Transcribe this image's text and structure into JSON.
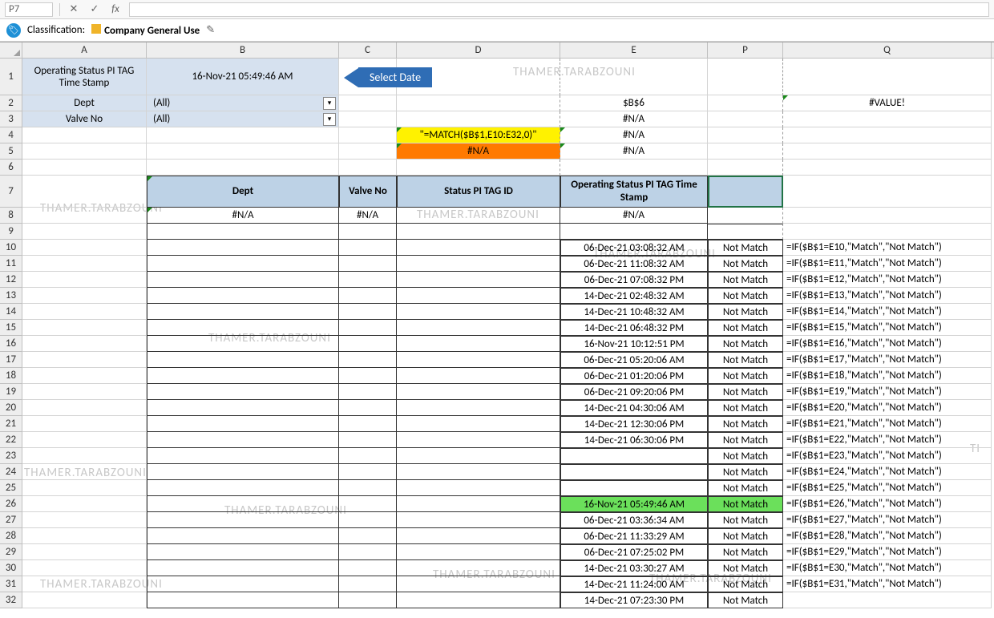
{
  "classification": {
    "label": "Classification:",
    "value": "Company General Use"
  },
  "nameBox": "P7",
  "columns": [
    "A",
    "B",
    "C",
    "D",
    "E",
    "P",
    "Q"
  ],
  "top": {
    "a1": "Operating Status PI TAG Time Stamp",
    "b1": "16-Nov-21 05:49:46 AM",
    "a2": "Dept",
    "b2": "(All)",
    "a3": "Valve No",
    "b3": "(All)",
    "d4": "\"=MATCH($B$1,E10:E32,0)\"",
    "d5": "#N/A",
    "e2": "$B$6",
    "e3": "#N/A",
    "e4": "#N/A",
    "e5": "#N/A",
    "q2": "#VALUE!"
  },
  "callout": "Select Date",
  "tableHeaders": {
    "b7": "Dept",
    "c7": "Valve No",
    "d7": "Status PI TAG ID",
    "e7": "Operating Status PI TAG Time Stamp"
  },
  "row8": {
    "b": "#N/A",
    "c": "#N/A",
    "e": "#N/A"
  },
  "dataRows": [
    {
      "r": 10,
      "e": "06-Dec-21 03:08:32 AM",
      "p": "Not Match",
      "q": "=IF($B$1=E10,\"Match\",\"Not Match\")"
    },
    {
      "r": 11,
      "e": "06-Dec-21 11:08:32 AM",
      "p": "Not Match",
      "q": "=IF($B$1=E11,\"Match\",\"Not Match\")"
    },
    {
      "r": 12,
      "e": "06-Dec-21 07:08:32 PM",
      "p": "Not Match",
      "q": "=IF($B$1=E12,\"Match\",\"Not Match\")"
    },
    {
      "r": 13,
      "e": "14-Dec-21 02:48:32 AM",
      "p": "Not Match",
      "q": "=IF($B$1=E13,\"Match\",\"Not Match\")"
    },
    {
      "r": 14,
      "e": "14-Dec-21 10:48:32 AM",
      "p": "Not Match",
      "q": "=IF($B$1=E14,\"Match\",\"Not Match\")"
    },
    {
      "r": 15,
      "e": "14-Dec-21 06:48:32 PM",
      "p": "Not Match",
      "q": "=IF($B$1=E15,\"Match\",\"Not Match\")"
    },
    {
      "r": 16,
      "e": "16-Nov-21 10:12:51 PM",
      "p": "Not Match",
      "q": "=IF($B$1=E16,\"Match\",\"Not Match\")"
    },
    {
      "r": 17,
      "e": "06-Dec-21 05:20:06 AM",
      "p": "Not Match",
      "q": "=IF($B$1=E17,\"Match\",\"Not Match\")"
    },
    {
      "r": 18,
      "e": "06-Dec-21 01:20:06 PM",
      "p": "Not Match",
      "q": "=IF($B$1=E18,\"Match\",\"Not Match\")"
    },
    {
      "r": 19,
      "e": "06-Dec-21 09:20:06 PM",
      "p": "Not Match",
      "q": "=IF($B$1=E19,\"Match\",\"Not Match\")"
    },
    {
      "r": 20,
      "e": "14-Dec-21 04:30:06 AM",
      "p": "Not Match",
      "q": "=IF($B$1=E20,\"Match\",\"Not Match\")"
    },
    {
      "r": 21,
      "e": "14-Dec-21 12:30:06 PM",
      "p": "Not Match",
      "q": "=IF($B$1=E21,\"Match\",\"Not Match\")"
    },
    {
      "r": 22,
      "e": "14-Dec-21 06:30:06 PM",
      "p": "Not Match",
      "q": "=IF($B$1=E22,\"Match\",\"Not Match\")"
    },
    {
      "r": 23,
      "e": "",
      "p": "Not Match",
      "q": "=IF($B$1=E23,\"Match\",\"Not Match\")"
    },
    {
      "r": 24,
      "e": "",
      "p": "Not Match",
      "q": "=IF($B$1=E24,\"Match\",\"Not Match\")"
    },
    {
      "r": 25,
      "e": "",
      "p": "Not Match",
      "q": "=IF($B$1=E25,\"Match\",\"Not Match\")"
    },
    {
      "r": 26,
      "e": "16-Nov-21 05:49:46 AM",
      "p": "Not Match",
      "q": "=IF($B$1=E26,\"Match\",\"Not Match\")",
      "hl": true
    },
    {
      "r": 27,
      "e": "06-Dec-21 03:36:34 AM",
      "p": "Not Match",
      "q": "=IF($B$1=E27,\"Match\",\"Not Match\")"
    },
    {
      "r": 28,
      "e": "06-Dec-21 11:33:29 AM",
      "p": "Not Match",
      "q": "=IF($B$1=E28,\"Match\",\"Not Match\")"
    },
    {
      "r": 29,
      "e": "06-Dec-21 07:25:02 PM",
      "p": "Not Match",
      "q": "=IF($B$1=E29,\"Match\",\"Not Match\")"
    },
    {
      "r": 30,
      "e": "14-Dec-21 03:30:27 AM",
      "p": "Not Match",
      "q": "=IF($B$1=E30,\"Match\",\"Not Match\")"
    },
    {
      "r": 31,
      "e": "14-Dec-21 11:24:00 AM",
      "p": "Not Match",
      "q": "=IF($B$1=E31,\"Match\",\"Not Match\")"
    },
    {
      "r": 32,
      "e": "14-Dec-21 07:23:30 PM",
      "p": "Not Match",
      "q": ""
    }
  ],
  "watermark": "THAMER.TARABZOUNI"
}
